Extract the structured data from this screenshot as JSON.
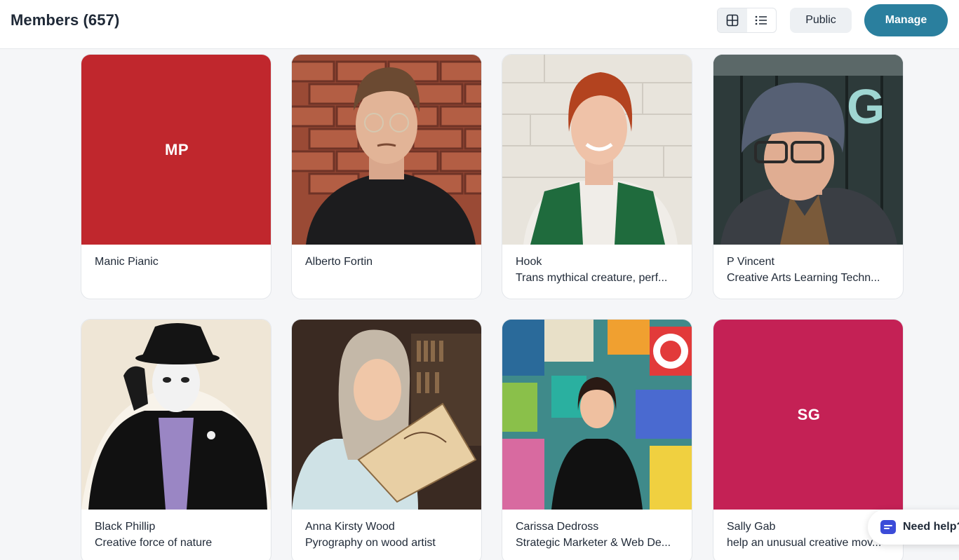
{
  "header": {
    "title": "Members (657)",
    "view_grid_icon": "grid-icon",
    "view_list_icon": "list-icon",
    "public_label": "Public",
    "manage_label": "Manage",
    "manage_color": "#2a7f9e"
  },
  "members": [
    {
      "name": "Manic Pianic",
      "bio": "",
      "initials": "MP",
      "avatar_color": "#c0272d"
    },
    {
      "name": "Alberto Fortin",
      "bio": "",
      "avatar": "photo"
    },
    {
      "name": "Hook",
      "bio": "Trans mythical creature, perf...",
      "avatar": "photo"
    },
    {
      "name": "P Vincent",
      "bio": "Creative Arts Learning Techn...",
      "avatar": "photo"
    },
    {
      "name": "Black Phillip",
      "bio": "Creative force of nature",
      "avatar": "photo"
    },
    {
      "name": "Anna Kirsty Wood",
      "bio": "Pyrography on wood artist",
      "avatar": "photo"
    },
    {
      "name": "Carissa Dedross",
      "bio": "Strategic Marketer & Web De...",
      "avatar": "photo"
    },
    {
      "name": "Sally Gab",
      "bio": "help an unusual creative mov...",
      "initials": "SG",
      "avatar_color": "#c42155"
    }
  ],
  "help": {
    "label": "Need help?",
    "icon": "chat-icon"
  }
}
